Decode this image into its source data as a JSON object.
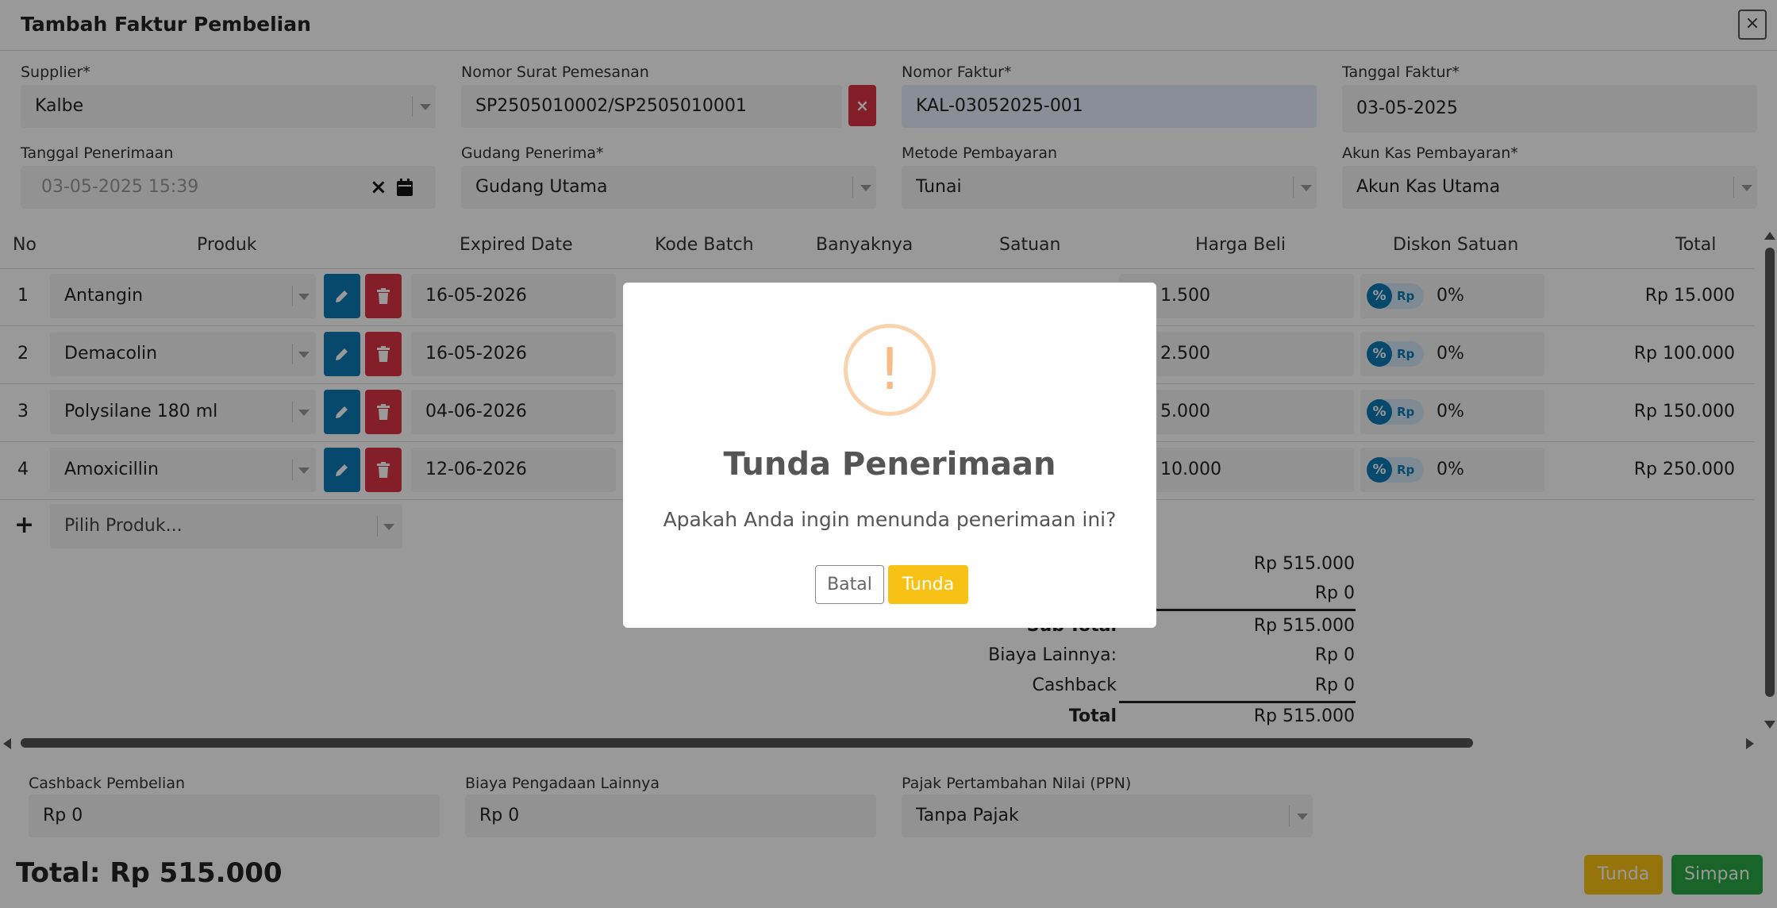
{
  "header": {
    "title": "Tambah Faktur Pembelian",
    "close": "×"
  },
  "form": {
    "supplier": {
      "label": "Supplier*",
      "value": "Kalbe"
    },
    "nomor_sp": {
      "label": "Nomor Surat Pemesanan",
      "value": "SP2505010002/SP2505010001",
      "clear": "×"
    },
    "nomor_faktur": {
      "label": "Nomor Faktur*",
      "value": "KAL-03052025-001"
    },
    "tanggal_faktur": {
      "label": "Tanggal Faktur*",
      "value": "03-05-2025"
    },
    "tanggal_penerimaan": {
      "label": "Tanggal Penerimaan",
      "value": "03-05-2025 15:39",
      "clear": "×"
    },
    "gudang": {
      "label": "Gudang Penerima*",
      "value": "Gudang Utama"
    },
    "metode": {
      "label": "Metode Pembayaran",
      "value": "Tunai"
    },
    "akun_kas": {
      "label": "Akun Kas Pembayaran*",
      "value": "Akun Kas Utama"
    }
  },
  "table": {
    "headers": [
      "No",
      "Produk",
      "Expired Date",
      "Kode Batch",
      "Banyaknya",
      "Satuan",
      "Harga Beli",
      "Diskon Satuan",
      "Total"
    ],
    "rows": [
      {
        "no": "1",
        "produk": "Antangin",
        "expired": "16-05-2026",
        "harga": "1.500",
        "diskon": "0%",
        "total": "Rp 15.000"
      },
      {
        "no": "2",
        "produk": "Demacolin",
        "expired": "16-05-2026",
        "harga": "2.500",
        "diskon": "0%",
        "total": "Rp 100.000"
      },
      {
        "no": "3",
        "produk": "Polysilane 180 ml",
        "expired": "04-06-2026",
        "harga": "5.000",
        "diskon": "0%",
        "total": "Rp 150.000"
      },
      {
        "no": "4",
        "produk": "Amoxicillin",
        "expired": "12-06-2026",
        "harga": "10.000",
        "diskon": "0%",
        "total": "Rp 250.000"
      }
    ],
    "discount_toggle": {
      "percent": "%",
      "rp": "Rp"
    },
    "add_symbol": "+",
    "add_placeholder": "Pilih Produk..."
  },
  "summary": {
    "line1": "Rp 515.000",
    "line2": "Rp 0",
    "subtotal_label": "Sub-Total",
    "subtotal": "Rp 515.000",
    "biaya_label": "Biaya Lainnya:",
    "biaya": "Rp 0",
    "cashback_label": "Cashback",
    "cashback": "Rp 0",
    "total_label": "Total",
    "total": "Rp 515.000"
  },
  "footer_fields": {
    "cashback_pembelian": {
      "label": "Cashback Pembelian",
      "value": "Rp 0"
    },
    "biaya_pengadaan": {
      "label": "Biaya Pengadaan Lainnya",
      "value": "Rp 0"
    },
    "ppn": {
      "label": "Pajak Pertambahan Nilai (PPN)",
      "value": "Tanpa Pajak"
    }
  },
  "footer": {
    "total_text": "Total: Rp 515.000",
    "tunda": "Tunda",
    "simpan": "Simpan"
  },
  "modal": {
    "icon": "!",
    "title": "Tunda Penerimaan",
    "text": "Apakah Anda ingin menunda penerimaan ini?",
    "batal": "Batal",
    "tunda": "Tunda"
  },
  "colors": {
    "primary": "#0d7bb5",
    "danger": "#dc3545",
    "warning": "#f8c115",
    "success": "#28a745"
  }
}
